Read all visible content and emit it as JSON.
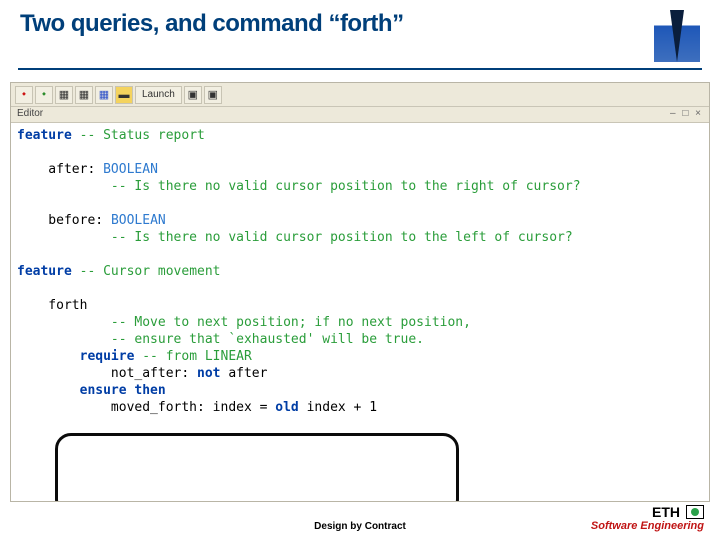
{
  "slide": {
    "title": "Two queries, and command “forth”"
  },
  "toolbar": {
    "launch_label": "Launch",
    "editor_label": "Editor",
    "window_controls": "– □ ×"
  },
  "code": {
    "l01a": "feature",
    "l01b": " -- Status report",
    "l03a": "    after",
    "l03b": ": ",
    "l03c": "BOOLEAN",
    "l04": "            -- Is there no valid cursor position to the right of cursor?",
    "l06a": "    before",
    "l06b": ": ",
    "l06c": "BOOLEAN",
    "l07": "            -- Is there no valid cursor position to the left of cursor?",
    "l09a": "feature",
    "l09b": " -- Cursor movement",
    "l11": "    forth",
    "l12": "            -- Move to next position; if no next position,",
    "l13": "            -- ensure that `exhausted' will be true.",
    "l14a": "        require",
    "l14b": " -- from LINEAR",
    "l15": "            not_after: ",
    "l15b": "not",
    "l15c": " after",
    "l16": "        ensure then",
    "l17": "            moved_forth: index = ",
    "l17b": "old",
    "l17c": " index + 1"
  },
  "footer": {
    "center": "Design by Contract",
    "eth": "ETH",
    "se": "Software Engineering"
  }
}
